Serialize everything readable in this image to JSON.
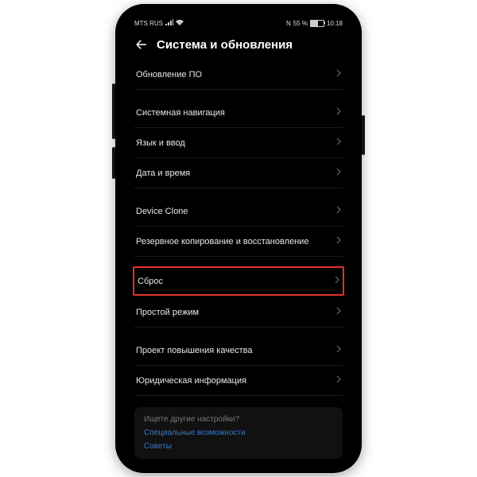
{
  "statusbar": {
    "carrier": "MTS RUS",
    "nfc": "N",
    "battery_pct": "55 %",
    "time": "10:18"
  },
  "header": {
    "title": "Система и обновления"
  },
  "items": [
    {
      "label": "Обновление ПО"
    },
    {
      "label": "Системная навигация"
    },
    {
      "label": "Язык и ввод"
    },
    {
      "label": "Дата и время"
    },
    {
      "label": "Device Clone"
    },
    {
      "label": "Резервное копирование и восстановление"
    },
    {
      "label": "Сброс"
    },
    {
      "label": "Простой режим"
    },
    {
      "label": "Проект повышения качества"
    },
    {
      "label": "Юридическая информация"
    }
  ],
  "help": {
    "prompt": "Ищете другие настройки?",
    "links": [
      "Специальные возможности",
      "Советы"
    ]
  },
  "highlight_index": 6
}
